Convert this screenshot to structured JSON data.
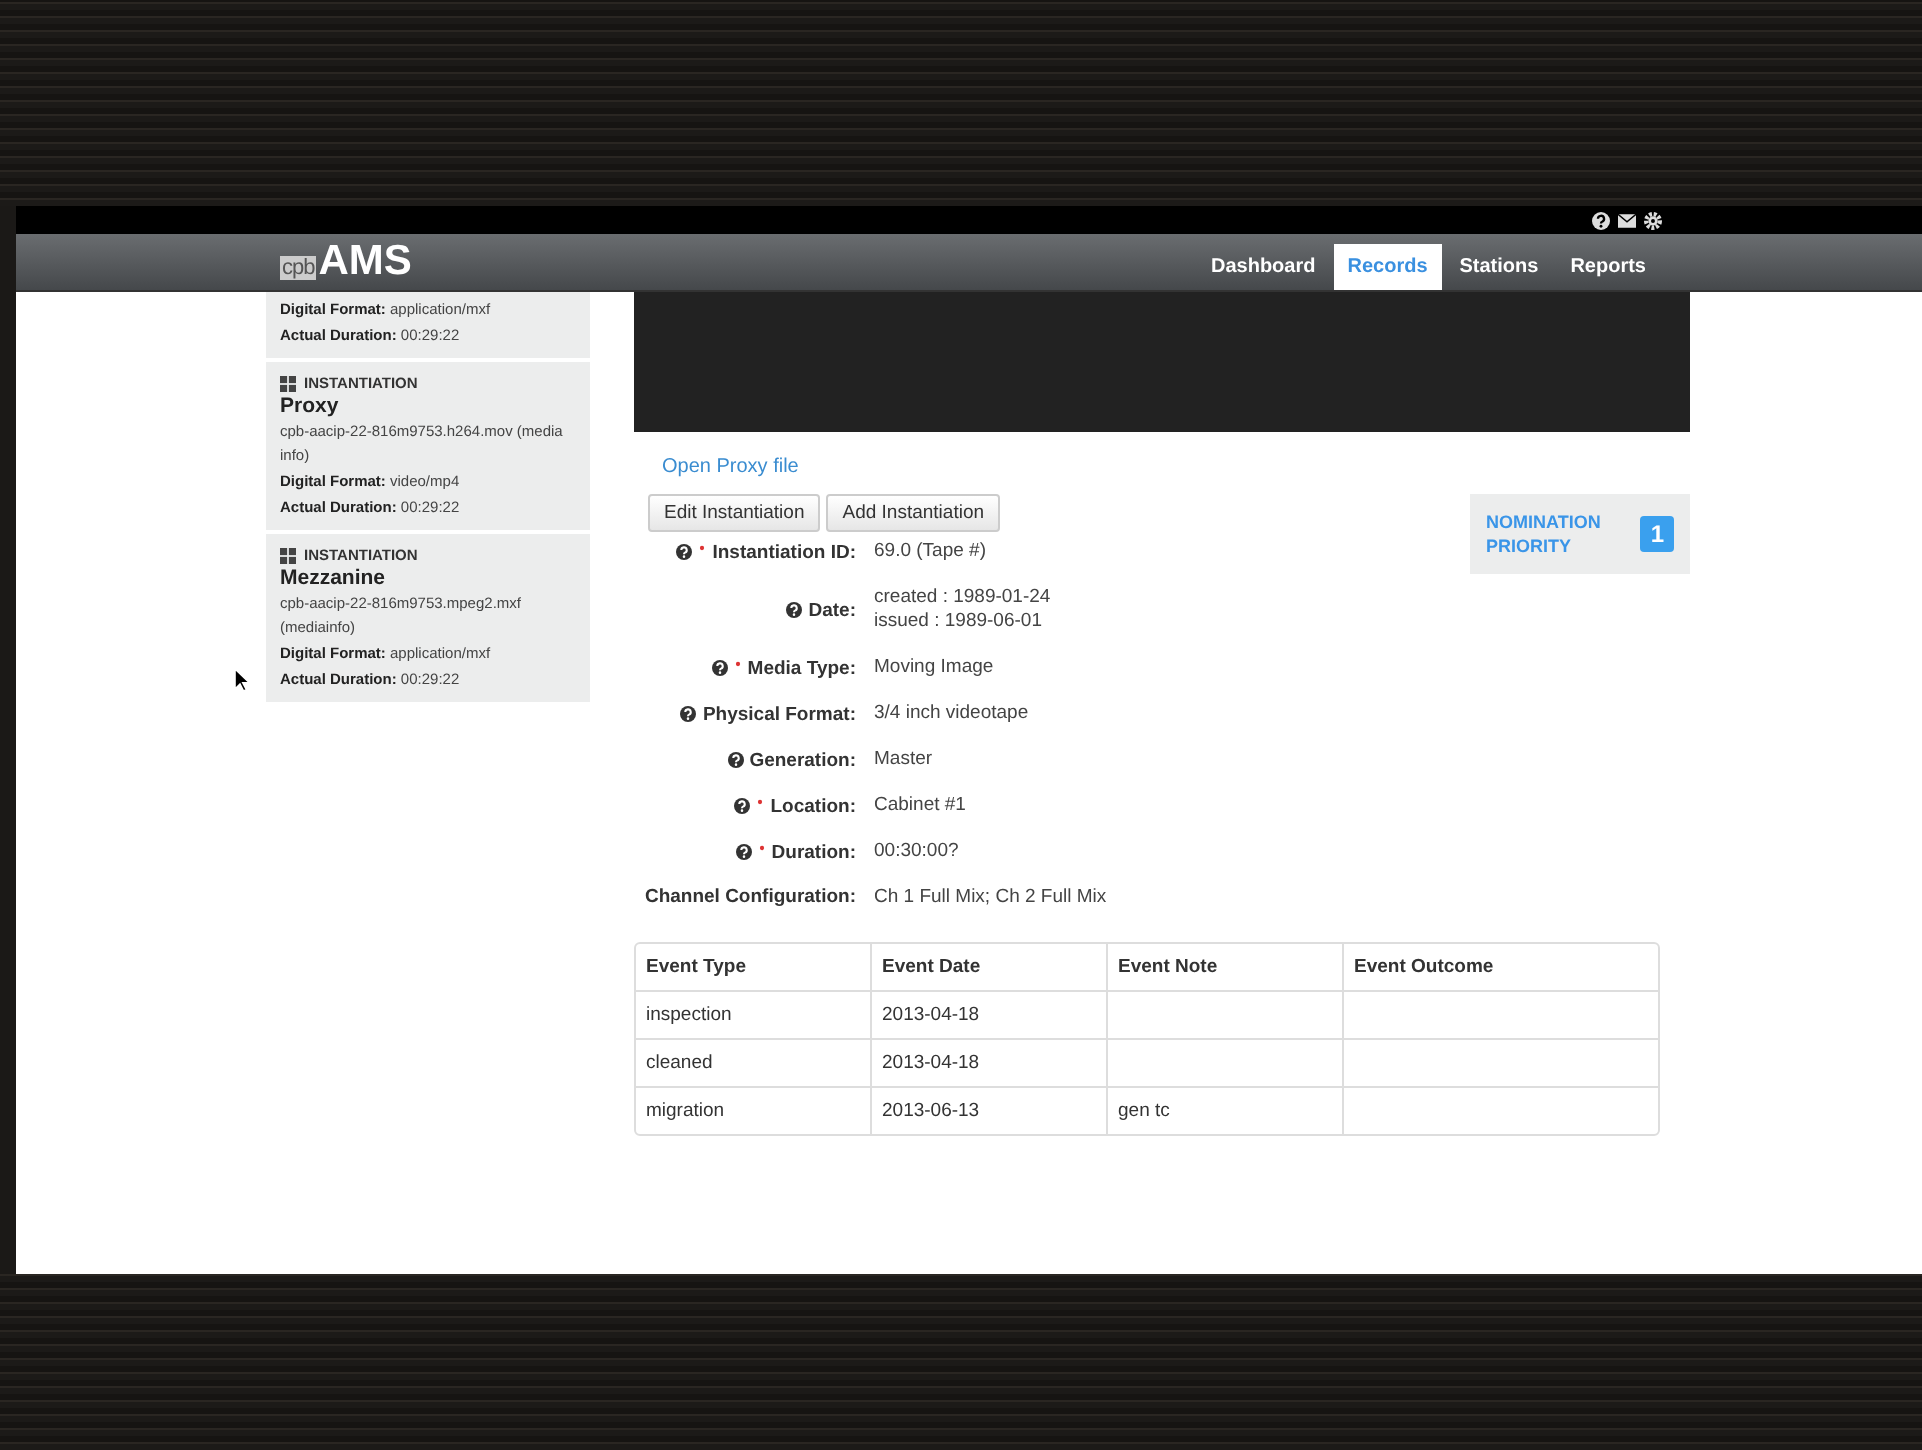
{
  "logo": {
    "mark": "cpb",
    "name": "AMS"
  },
  "nav": [
    {
      "label": "Dashboard",
      "selected": false
    },
    {
      "label": "Records",
      "selected": true
    },
    {
      "label": "Stations",
      "selected": false
    },
    {
      "label": "Reports",
      "selected": false
    }
  ],
  "sidebar": {
    "items": [
      {
        "kind": "partial",
        "fields": [
          {
            "label": "Digital Format:",
            "value": "application/mxf"
          },
          {
            "label": "Actual Duration:",
            "value": "00:29:22"
          }
        ]
      },
      {
        "kind": "instantiation",
        "type": "INSTANTIATION",
        "title": "Proxy",
        "file": "cpb-aacip-22-816m9753.h264.mov (media info)",
        "fields": [
          {
            "label": "Digital Format:",
            "value": "video/mp4"
          },
          {
            "label": "Actual Duration:",
            "value": "00:29:22"
          }
        ]
      },
      {
        "kind": "instantiation",
        "type": "INSTANTIATION",
        "title": "Mezzanine",
        "file": "cpb-aacip-22-816m9753.mpeg2.mxf (mediainfo)",
        "fields": [
          {
            "label": "Digital Format:",
            "value": "application/mxf"
          },
          {
            "label": "Actual Duration:",
            "value": "00:29:22"
          }
        ]
      }
    ]
  },
  "proxy_link": "Open Proxy file",
  "buttons": [
    "Edit Instantiation",
    "Add Instantiation"
  ],
  "nomination": {
    "label": "NOMINATION PRIORITY",
    "value": "1"
  },
  "fields": [
    {
      "label": "Instantiation ID:",
      "required": true,
      "help": true,
      "values": [
        "69.0 (Tape #)"
      ]
    },
    {
      "label": "Date:",
      "required": false,
      "help": true,
      "values": [
        "created : 1989-01-24",
        "issued : 1989-06-01"
      ]
    },
    {
      "label": "Media Type:",
      "required": true,
      "help": true,
      "values": [
        "Moving Image"
      ]
    },
    {
      "label": "Physical Format:",
      "required": false,
      "help": true,
      "values": [
        "3/4 inch videotape"
      ]
    },
    {
      "label": "Generation:",
      "required": false,
      "help": true,
      "values": [
        "Master"
      ]
    },
    {
      "label": "Location:",
      "required": true,
      "help": true,
      "values": [
        "Cabinet #1"
      ]
    },
    {
      "label": "Duration:",
      "required": true,
      "help": true,
      "values": [
        "00:30:00?"
      ]
    },
    {
      "label": "Channel Configuration:",
      "required": false,
      "help": false,
      "values": [
        "Ch 1 Full Mix; Ch 2 Full Mix"
      ]
    }
  ],
  "events": {
    "columns": [
      "Event Type",
      "Event Date",
      "Event Note",
      "Event Outcome"
    ],
    "rows": [
      {
        "event_type": "inspection",
        "event_date": "2013-04-18"
      },
      {
        "event_type": "cleaned",
        "event_date": "2013-04-18"
      },
      {
        "event_type": "migration",
        "event_date": "2013-06-13",
        "event_note": "gen tc"
      }
    ]
  }
}
